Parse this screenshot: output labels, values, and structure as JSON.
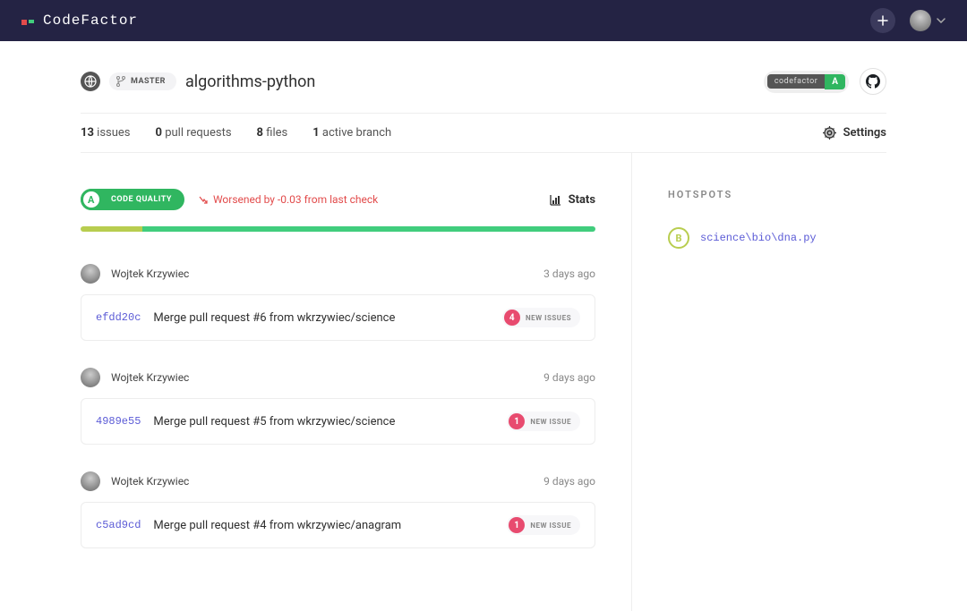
{
  "brand": "CodeFactor",
  "header": {
    "branch": "MASTER",
    "repo": "algorithms-python",
    "grade_label": "codefactor",
    "grade_letter": "A"
  },
  "tabs": {
    "issues_count": "13",
    "issues_label": "issues",
    "pr_count": "0",
    "pr_label": "pull requests",
    "files_count": "8",
    "files_label": "files",
    "branch_count": "1",
    "branch_label": "active branch",
    "settings": "Settings"
  },
  "quality": {
    "badge_letter": "A",
    "badge_label": "CODE QUALITY",
    "trend": "Worsened by -0.03 from last check",
    "stats": "Stats"
  },
  "commits": [
    {
      "author": "Wojtek Krzywiec",
      "time": "3 days ago",
      "sha": "efdd20c",
      "message": "Merge pull request #6 from wkrzywiec/science",
      "issues_count": "4",
      "issues_label": "NEW ISSUES"
    },
    {
      "author": "Wojtek Krzywiec",
      "time": "9 days ago",
      "sha": "4989e55",
      "message": "Merge pull request #5 from wkrzywiec/science",
      "issues_count": "1",
      "issues_label": "NEW ISSUE"
    },
    {
      "author": "Wojtek Krzywiec",
      "time": "9 days ago",
      "sha": "c5ad9cd",
      "message": "Merge pull request #4 from wkrzywiec/anagram",
      "issues_count": "1",
      "issues_label": "NEW ISSUE"
    }
  ],
  "hotspots": {
    "title": "HOTSPOTS",
    "items": [
      {
        "grade": "B",
        "path": "science\\bio\\dna.py"
      }
    ]
  }
}
